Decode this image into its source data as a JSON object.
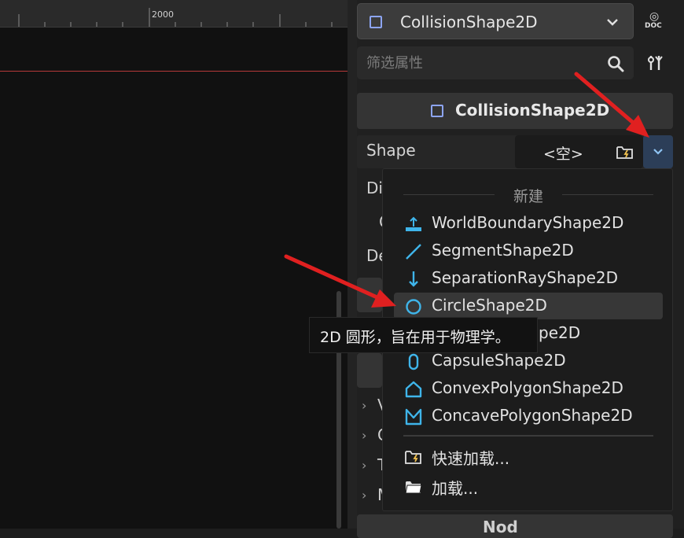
{
  "viewport": {
    "ruler_label": "2000"
  },
  "inspector": {
    "node_selector": {
      "label": "CollisionShape2D",
      "icon": "collision-shape-2d-icon"
    },
    "doc_button": {
      "label": "DOC"
    },
    "filter": {
      "placeholder": "筛选属性"
    },
    "section": {
      "title": "CollisionShape2D"
    },
    "shape_property": {
      "label": "Shape",
      "value": "<空>"
    },
    "partially_hidden": {
      "di": "Di",
      "o": "O",
      "de": "De",
      "v": "V",
      "c": "C",
      "t": "T",
      "m": "M",
      "node_btn": "Nod"
    }
  },
  "menu": {
    "header": "新建",
    "items": [
      {
        "label": "WorldBoundaryShape2D",
        "icon": "world-boundary-icon"
      },
      {
        "label": "SegmentShape2D",
        "icon": "segment-icon"
      },
      {
        "label": "SeparationRayShape2D",
        "icon": "separation-ray-icon"
      },
      {
        "label": "CircleShape2D",
        "icon": "circle-icon"
      },
      {
        "label": "pe2D",
        "icon": "rectangle-icon"
      },
      {
        "label": "CapsuleShape2D",
        "icon": "capsule-icon"
      },
      {
        "label": "ConvexPolygonShape2D",
        "icon": "convex-polygon-icon"
      },
      {
        "label": "ConcavePolygonShape2D",
        "icon": "concave-polygon-icon"
      }
    ],
    "quick_load": "快速加载...",
    "load": "加载..."
  },
  "tooltip": {
    "text": "2D 圆形，旨在用于物理学。"
  },
  "colors": {
    "accent_blue": "#8da5f3",
    "shape_blue": "#3fb5ea",
    "arrow_red": "#e02020"
  }
}
